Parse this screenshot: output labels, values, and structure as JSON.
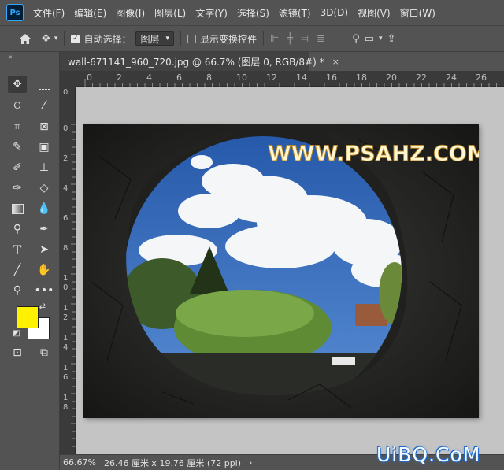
{
  "app": {
    "logo": "Ps"
  },
  "menu": [
    "文件(F)",
    "编辑(E)",
    "图像(I)",
    "图层(L)",
    "文字(Y)",
    "选择(S)",
    "滤镜(T)",
    "3D(D)",
    "视图(V)",
    "窗口(W)"
  ],
  "options": {
    "auto_select_label": "自动选择：",
    "auto_select_checked": true,
    "layer_select_value": "图层",
    "show_transform_label": "显示变换控件",
    "show_transform_checked": false
  },
  "document": {
    "tab_title": "wall-671141_960_720.jpg @ 66.7% (图层 0, RGB/8#) *",
    "close_glyph": "×"
  },
  "ruler": {
    "h_labels": [
      "0",
      "2",
      "4",
      "6",
      "8",
      "10",
      "12",
      "14",
      "16",
      "18",
      "20",
      "22",
      "24",
      "26"
    ],
    "v_labels": [
      "0",
      "2",
      "4",
      "6",
      "8",
      "1",
      "0",
      "1",
      "2",
      "1",
      "4",
      "1",
      "6",
      "1",
      "8"
    ]
  },
  "canvas_text": "WWW.PSAHZ.COM",
  "status": {
    "zoom": "66.67%",
    "doc_info": "26.46 厘米 x 19.76 厘米 (72 ppi)",
    "arrow": "›"
  },
  "watermark": "UiBQ.CoM",
  "colors": {
    "foreground": "#fff200",
    "background": "#ffffff",
    "ui_bg": "#535353",
    "sky": "#2f6fc7"
  },
  "icons": [
    "photoshop-logo",
    "home-icon",
    "move-icon",
    "marquee-icon",
    "lasso-icon",
    "magic-wand-icon",
    "crop-icon",
    "frame-icon",
    "eyedropper-icon",
    "patch-icon",
    "brush-icon",
    "stamp-icon",
    "history-brush-icon",
    "eraser-icon",
    "gradient-icon",
    "blur-icon",
    "dodge-icon",
    "pen-icon",
    "type-icon",
    "path-select-icon",
    "line-icon",
    "hand-icon",
    "zoom-icon",
    "more-icon",
    "quick-mask-icon",
    "screen-mode-icon",
    "search-icon",
    "workspace-icon",
    "share-icon"
  ]
}
